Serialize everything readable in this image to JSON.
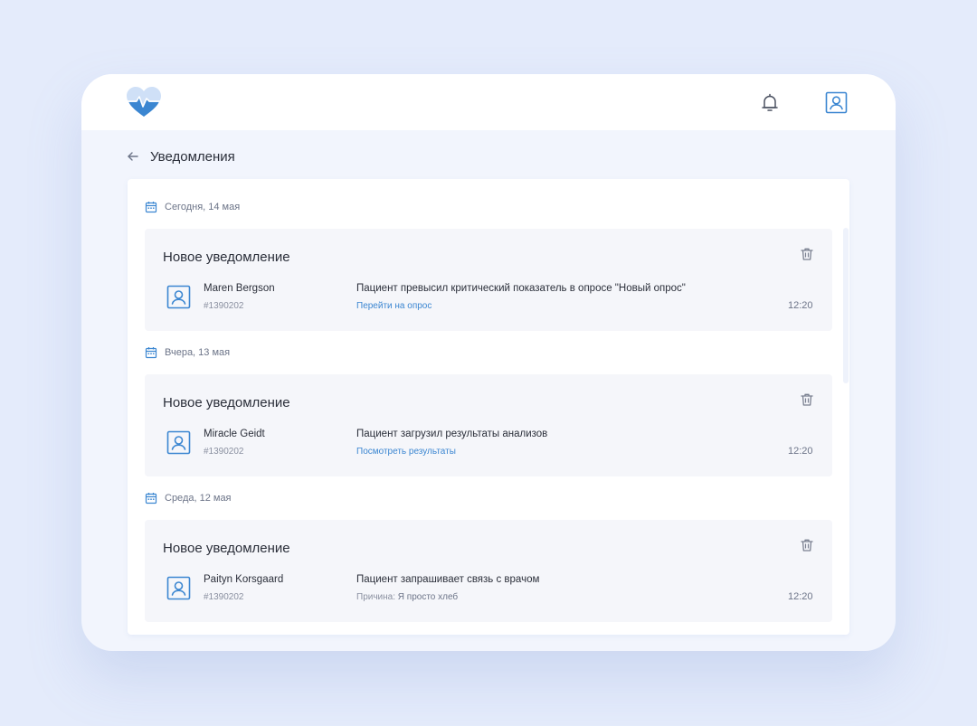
{
  "header": {
    "logo_icon": "heart-pulse-logo-icon",
    "notifications_icon": "bell-icon",
    "profile_icon": "user-profile-icon"
  },
  "page": {
    "title": "Уведомления",
    "back_icon": "arrow-left-icon"
  },
  "colors": {
    "accent": "#3b86d1",
    "background": "#e4ebfb",
    "card": "#f5f6fa",
    "text": "#2b2f3a",
    "muted": "#6c7488"
  },
  "groups": [
    {
      "date": "Сегодня, 14 мая",
      "notification": {
        "title": "Новое уведомление",
        "patient_name": "Maren Bergson",
        "patient_id": "#1390202",
        "message": "Пациент превысил критический показатель в опросе \"Новый опрос\"",
        "link": "Перейти на опрос",
        "time": "12:20"
      }
    },
    {
      "date": "Вчера, 13 мая",
      "notification": {
        "title": "Новое уведомление",
        "patient_name": "Miracle Geidt",
        "patient_id": "#1390202",
        "message": "Пациент загрузил результаты анализов",
        "link": "Посмотреть результаты",
        "time": "12:20"
      }
    },
    {
      "date": "Среда, 12 мая",
      "notification": {
        "title": "Новое уведомление",
        "patient_name": "Paityn Korsgaard",
        "patient_id": "#1390202",
        "message": "Пациент запрашивает связь с врачом",
        "reason_label": "Причина:",
        "reason_value": "Я просто хлеб",
        "time": "12:20"
      }
    }
  ]
}
